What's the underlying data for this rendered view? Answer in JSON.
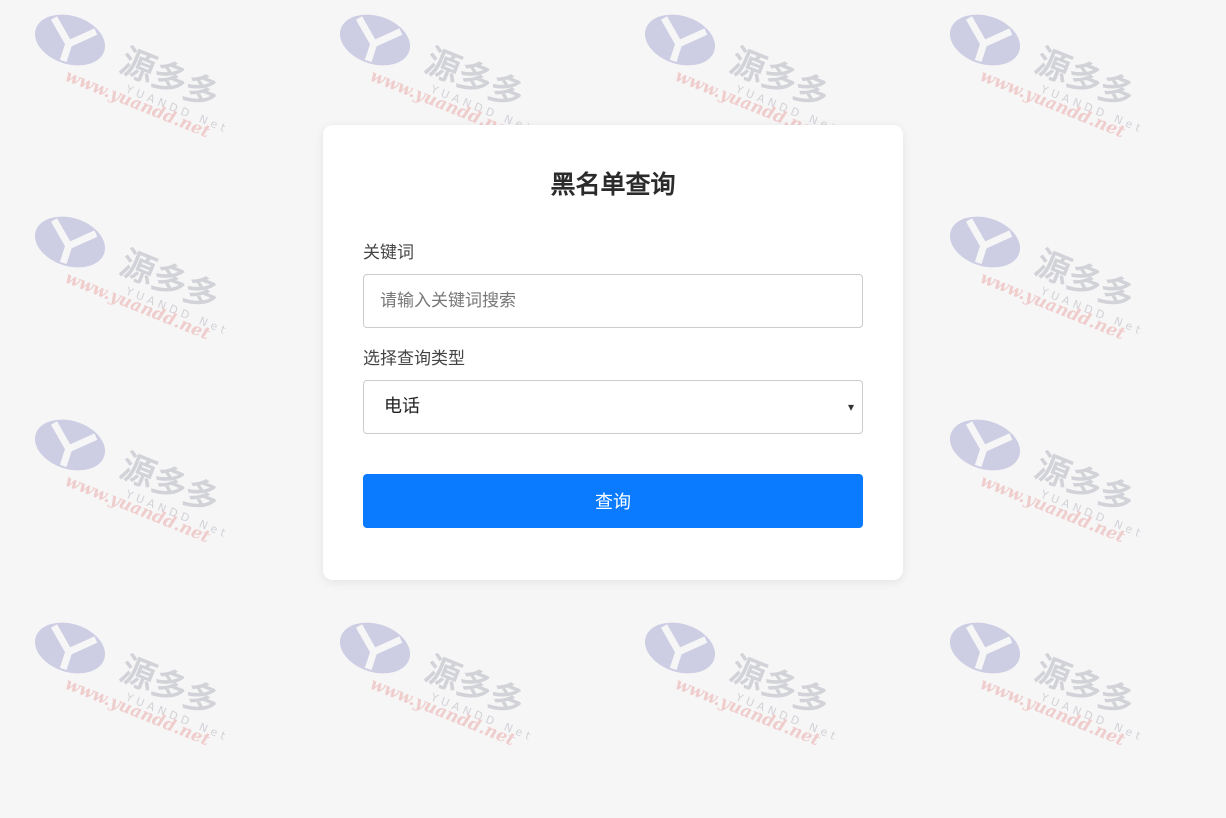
{
  "page": {
    "title": "黑名单查询"
  },
  "form": {
    "keyword_label": "关键词",
    "keyword_value": "",
    "keyword_placeholder": "请输入关键词搜索",
    "type_label": "选择查询类型",
    "type_selected": "电话",
    "caret": "▾",
    "submit_label": "查询"
  },
  "watermark": {
    "brand": "源多多",
    "sub": "YUANDD Net",
    "url": "www.yuandd.net",
    "logo_color": "#c9c9e3",
    "text_color": "#cfcfd6",
    "url_color": "#f0c9c9"
  },
  "colors": {
    "background": "#f6f6f6",
    "card": "#ffffff",
    "primary": "#0a7bff"
  }
}
